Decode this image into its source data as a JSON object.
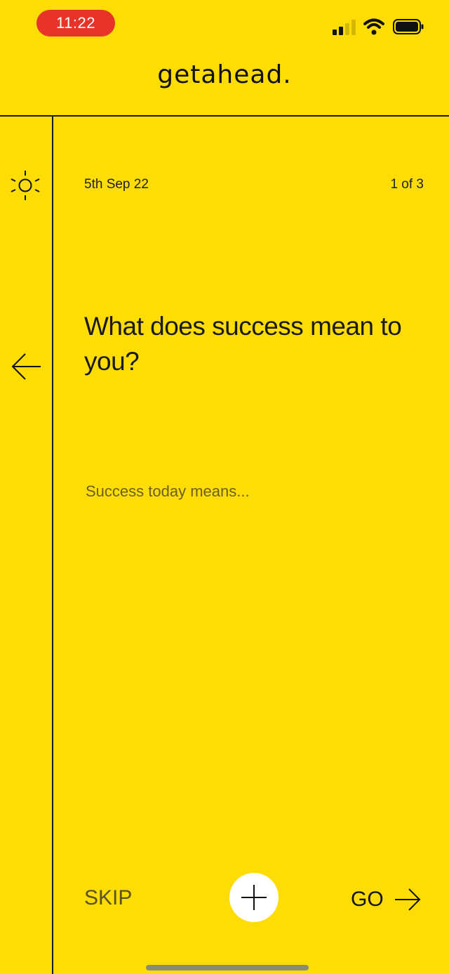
{
  "status_bar": {
    "time": "11:22"
  },
  "header": {
    "logo": "getahead."
  },
  "entry": {
    "date": "5th Sep 22",
    "counter": "1 of 3"
  },
  "prompt": {
    "question": "What does success mean to you?",
    "placeholder": "Success today means..."
  },
  "footer": {
    "skip_label": "SKIP",
    "go_label": "GO"
  },
  "colors": {
    "background": "#FEDC06",
    "time_pill": "#E8332A",
    "text": "#111111"
  }
}
